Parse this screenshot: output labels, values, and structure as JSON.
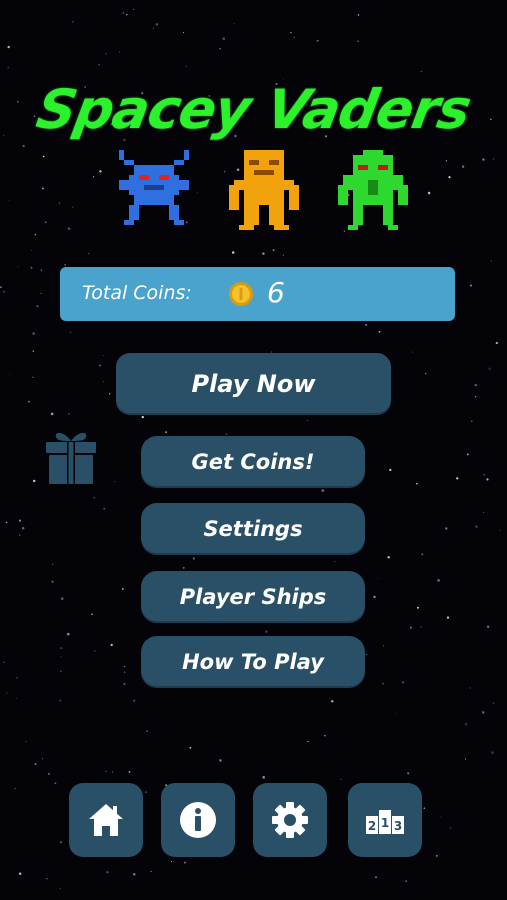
{
  "game": {
    "title": "Spacey Vaders"
  },
  "invaders": [
    {
      "name": "blue-invader",
      "color": "#2f6fe0",
      "eye": "#e02424"
    },
    {
      "name": "orange-invader",
      "color": "#f2a20c",
      "eye": "#8a4b00"
    },
    {
      "name": "green-invader",
      "color": "#2ed82e",
      "eye": "#c21b1b"
    }
  ],
  "coins": {
    "label": "Total Coins:",
    "value": "6",
    "icon": "coin-icon"
  },
  "menu": {
    "play_now": "Play Now",
    "get_coins": "Get Coins!",
    "settings": "Settings",
    "player_ships": "Player Ships",
    "how_to_play": "How To Play"
  },
  "bottom_bar": {
    "home": "home-icon",
    "info": "info-icon",
    "settings": "gear-icon",
    "leaderboard": {
      "icon": "podium-icon",
      "places": [
        "2",
        "1",
        "3"
      ]
    }
  },
  "colors": {
    "title": "#2cf22c",
    "coins_bar": "#4aa3cd",
    "button": "#2a5068",
    "background": "#030308"
  }
}
